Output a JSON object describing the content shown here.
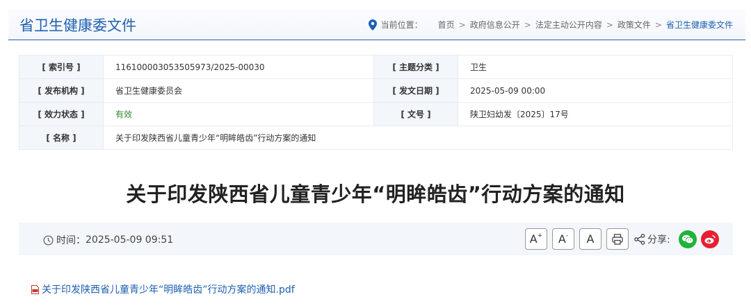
{
  "header": {
    "title": "省卫生健康委文件",
    "location_label": "当前位置：",
    "crumbs": [
      "首页",
      "政府信息公开",
      "法定主动公开内容",
      "政策文件",
      "省卫生健康委文件"
    ]
  },
  "meta": {
    "index_key": "[ 索引号 ]",
    "index_val": "116100003053505973/2025-00030",
    "topic_key": "[ 主题分类 ]",
    "topic_val": "卫生",
    "org_key": "[ 发布机构 ]",
    "org_val": "省卫生健康委员会",
    "date_key": "[ 发文日期 ]",
    "date_val": "2025-05-09 00:00",
    "status_key": "[ 效力状态 ]",
    "status_val": "有效",
    "docno_key": "[ 文号 ]",
    "docno_val": "陕卫妇幼发〔2025〕17号",
    "name_key": "[ 名称 ]",
    "name_val": "关于印发陕西省儿童青少年“明眸皓齿”行动方案的通知"
  },
  "article": {
    "title": "关于印发陕西省儿童青少年“明眸皓齿”行动方案的通知",
    "time_label": "时间：",
    "time_val": "2025-05-09 09:51",
    "font_large": "A",
    "font_small": "A",
    "font_normal": "A",
    "share_label": "分享:",
    "attachment": "关于印发陕西省儿童青少年“明眸皓齿”行动方案的通知.pdf"
  },
  "colors": {
    "accent": "#1e5fb0",
    "valid": "#2e8b2e",
    "wechat": "#1fb33a",
    "weibo": "#e6212f"
  },
  "icons": [
    "location-pin-icon",
    "clock-icon",
    "print-icon",
    "share-icon",
    "wechat-icon",
    "weibo-icon",
    "pdf-icon"
  ]
}
